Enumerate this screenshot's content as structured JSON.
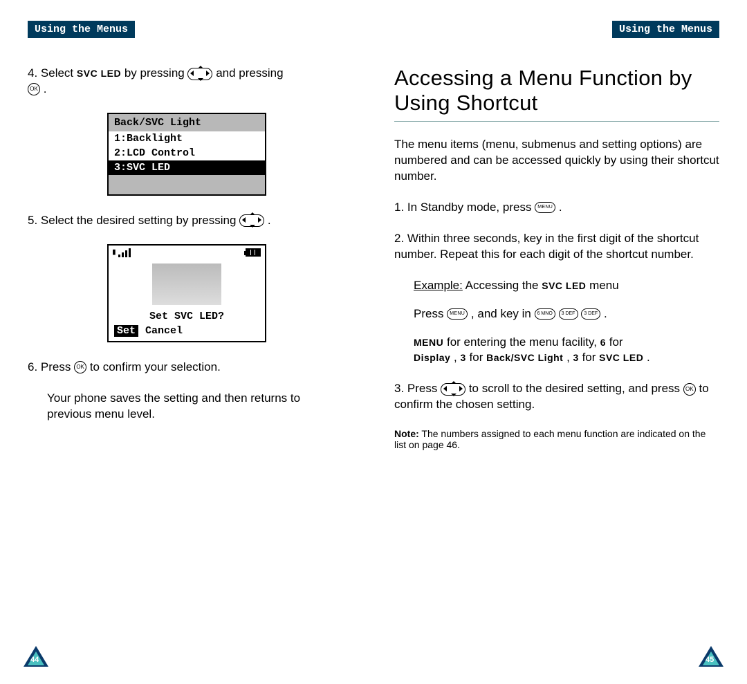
{
  "header": {
    "text": "Using the Menus"
  },
  "left": {
    "step4_a": "4. Select",
    "step4_sc": "SVC LED",
    "step4_b": " by pressing ",
    "step4_c": " and pressing",
    "lcd1": {
      "title": "Back/SVC Light",
      "r1": "1:Backlight",
      "r2": "2:LCD Control",
      "r3": "3:SVC LED"
    },
    "step5": "5. Select the desired setting by pressing ",
    "lcd2": {
      "q": "Set SVC LED?",
      "set": "Set",
      "cancel": "Cancel"
    },
    "step6_a": "6. Press ",
    "step6_b": " to confirm your selection.",
    "step6_c": "Your phone saves the setting and then returns to previous menu level."
  },
  "right": {
    "title": "Accessing a Menu Function by Using Shortcut",
    "intro": "The menu items (menu, submenus and setting options) are numbered and can be accessed quickly by using their shortcut number.",
    "step1_a": "1. In Standby mode, press ",
    "step2": "2. Within three seconds, key in the first digit of the shortcut number. Repeat this for each digit of the shortcut number.",
    "ex_label": "Example:",
    "ex_a": " Accessing the ",
    "ex_sc": "SVC LED",
    "ex_b": " menu",
    "press_a": "Press ",
    "press_b": " , and key in ",
    "keys": [
      "6 MNO",
      "3 DEF",
      "3 DEF"
    ],
    "menu_sc": "MENU",
    "menu_a": " for entering the menu facility, ",
    "six": "6",
    "menu_b": " for ",
    "disp_sc": "Display",
    "menu_c": " , ",
    "three": "3",
    "menu_d": " for ",
    "back_sc": "Back/SVC Light",
    "menu_e": " , ",
    "menu_f": " for ",
    "svc_sc": "SVC LED",
    "dot": " .",
    "step3_a": "3. Press ",
    "step3_b": " to scroll to the desired setting, and press ",
    "step3_c": " to confirm the chosen setting.",
    "note_label": "Note:",
    "note_text": " The numbers assigned to each menu function are indicated on the list on page 46."
  },
  "pages": {
    "left": "44",
    "right": "45"
  },
  "btn": {
    "ok": "OK",
    "menu": "MENU"
  }
}
